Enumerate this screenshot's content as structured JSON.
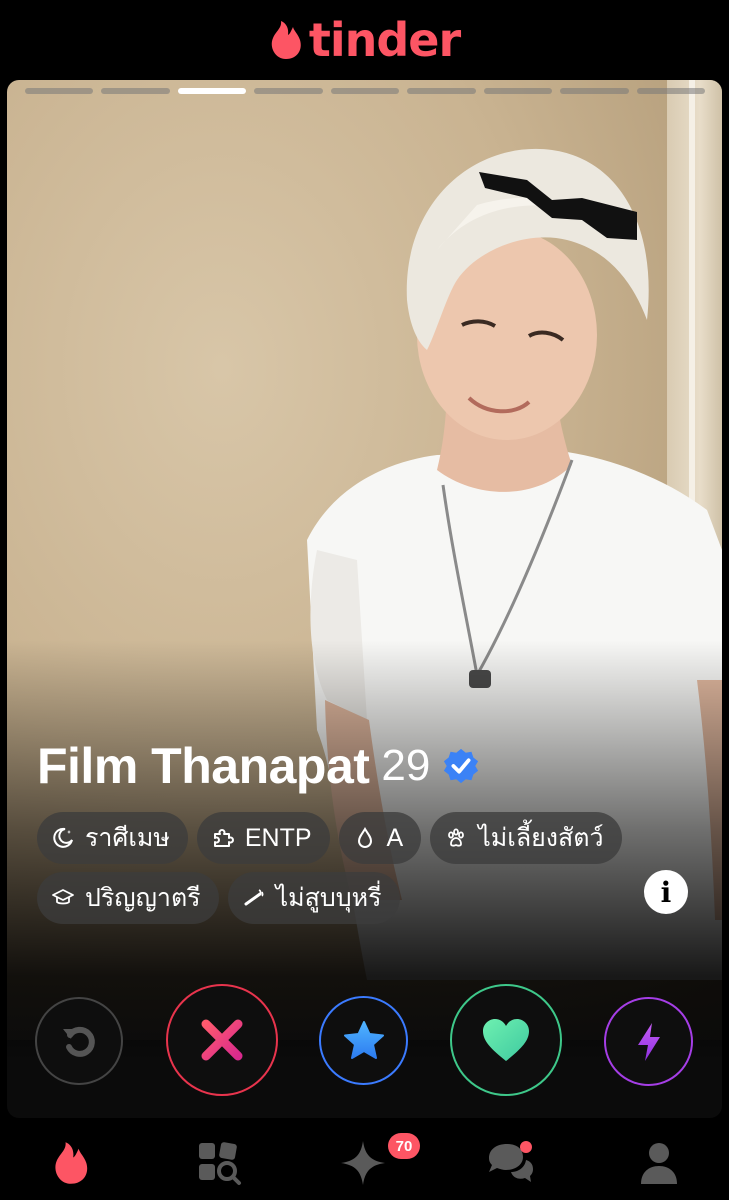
{
  "app": {
    "logo_text": "tinder",
    "brand_color": "#fd5564"
  },
  "card": {
    "photo_count": 9,
    "active_photo_index": 2,
    "name": "Film Thanapat",
    "age": "29",
    "verified": true,
    "chips": [
      {
        "icon": "moon-star-icon",
        "label": "ราศีเมษ"
      },
      {
        "icon": "puzzle-icon",
        "label": "ENTP"
      },
      {
        "icon": "drop-icon",
        "label": "A"
      },
      {
        "icon": "paw-icon",
        "label": "ไม่เลี้ยงสัตว์"
      },
      {
        "icon": "graduation-cap-icon",
        "label": "ปริญญาตรี"
      },
      {
        "icon": "smoking-icon",
        "label": "ไม่สูบบุหรี่"
      }
    ],
    "info_label": "i"
  },
  "actions": [
    {
      "name": "rewind",
      "icon": "rewind-icon",
      "color": "#f1b42f"
    },
    {
      "name": "nope",
      "icon": "close-icon",
      "color": "#e8344d"
    },
    {
      "name": "super-like",
      "icon": "star-icon",
      "color": "#3b9bff"
    },
    {
      "name": "like",
      "icon": "heart-icon",
      "color": "#5be0a2"
    },
    {
      "name": "boost",
      "icon": "lightning-icon",
      "color": "#b54ef2"
    }
  ],
  "tabbar": {
    "items": [
      {
        "name": "swipe",
        "icon": "flame-icon",
        "active": true
      },
      {
        "name": "explore",
        "icon": "explore-grid-icon",
        "active": false
      },
      {
        "name": "gold-home",
        "icon": "sparkle-icon",
        "active": false
      },
      {
        "name": "messages",
        "icon": "chat-icon",
        "active": false
      },
      {
        "name": "profile",
        "icon": "person-icon",
        "active": false
      }
    ],
    "likes_badge": "70"
  }
}
